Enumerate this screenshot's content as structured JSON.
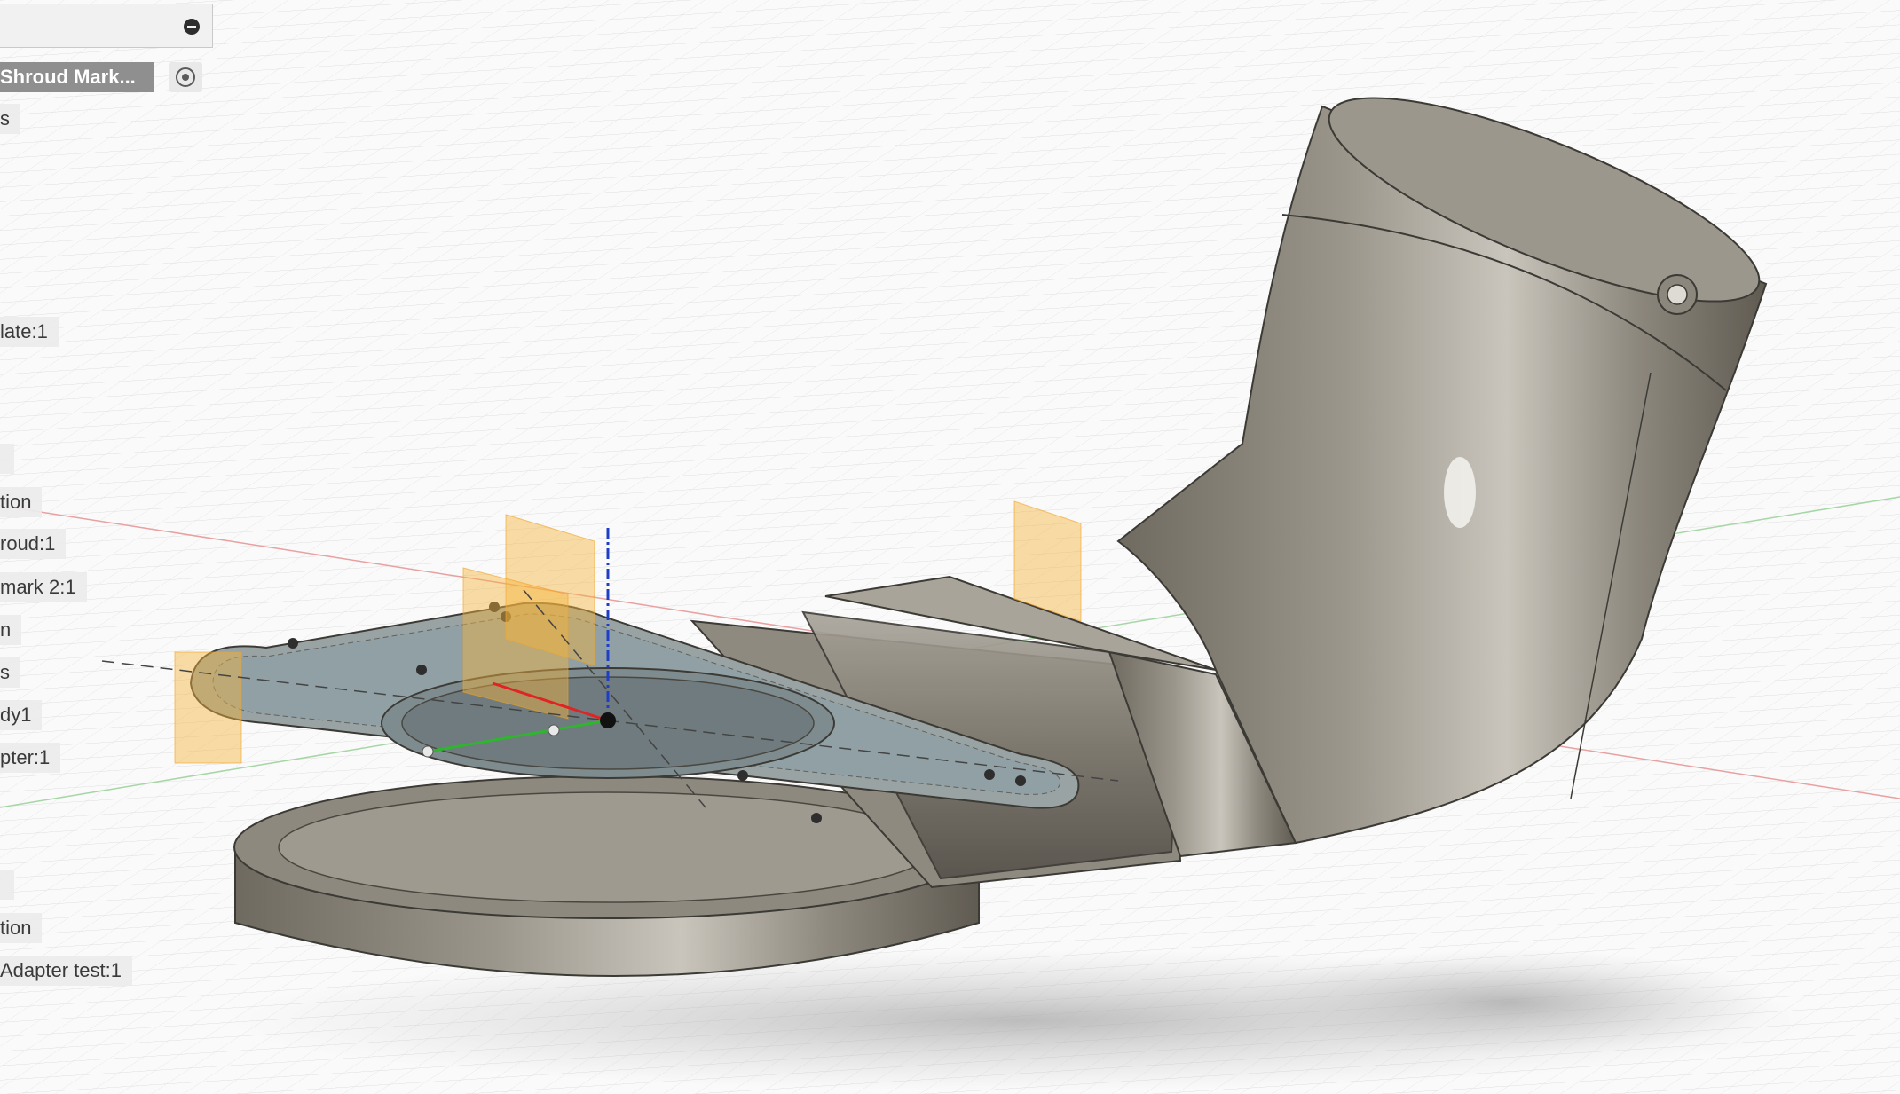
{
  "app": {
    "accent_color": "#2f56c4",
    "selection_color": "#8f8f8f",
    "workplane_color": "#f5b43c"
  },
  "browser": {
    "collapse_icon": "collapse-icon",
    "visibility_icon": "eye-radio-icon",
    "nodes": [
      {
        "label": "Shroud Mark...",
        "selected": true
      },
      {
        "label": "s"
      },
      {
        "label": "late:1"
      },
      {
        "label": ""
      },
      {
        "label": "tion"
      },
      {
        "label": "roud:1"
      },
      {
        "label": "mark 2:1"
      },
      {
        "label": "n"
      },
      {
        "label": "s"
      },
      {
        "label": "dy1"
      },
      {
        "label": "pter:1"
      },
      {
        "label": ""
      },
      {
        "label": "tion"
      },
      {
        "label": "Adapter test:1"
      }
    ]
  }
}
